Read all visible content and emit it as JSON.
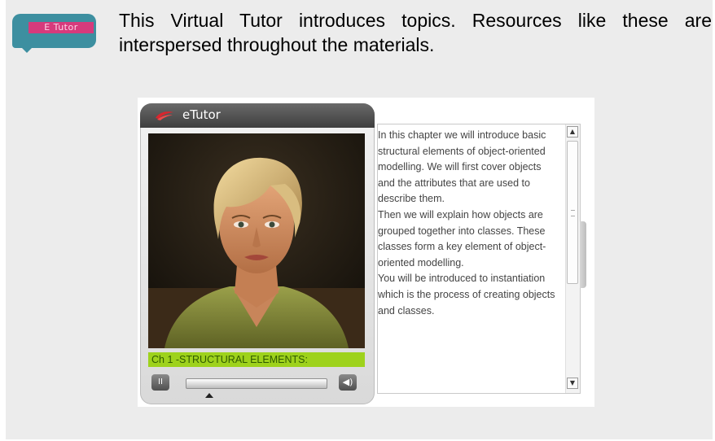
{
  "badge": {
    "label": "E Tutor"
  },
  "intro": {
    "text": "This Virtual Tutor introduces topics. Resources like these are interspersed throughout the materials."
  },
  "player": {
    "title": "eTutor",
    "chapter": "Ch 1 -STRUCTURAL ELEMENTS:",
    "pause_symbol": "II",
    "volume_symbol": "◀)",
    "progress_fraction": 0.0
  },
  "transcript": {
    "paragraphs": [
      "In this chapter we will introduce basic structural elements of object-oriented modelling. We will first cover objects and the attributes that are used to describe them.",
      "Then we will explain how objects are grouped together into classes. These classes form a key element of object-oriented modelling.",
      "You will be introduced to instantiation which is the process of creating objects and classes."
    ]
  },
  "colors": {
    "panel_bg": "#ececec",
    "chapter_bar": "#9ed21c",
    "badge_bg": "#3d8fa0",
    "badge_label": "#d63a7c",
    "logo_red": "#d8262e"
  },
  "icons": {
    "logo": "etutor-swoosh-icon",
    "pause": "pause-icon",
    "volume": "speaker-icon",
    "scroll_up": "arrow-up-icon",
    "scroll_down": "arrow-down-icon"
  }
}
